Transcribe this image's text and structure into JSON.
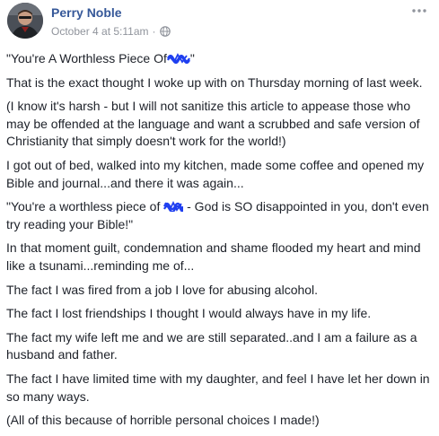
{
  "post": {
    "author_name": "Perry Noble",
    "timestamp": "October 4 at 5:11am",
    "separator": "·",
    "audience_icon": "globe-icon",
    "more_icon": "more-options-icon",
    "censor_color": "#1f3ff0",
    "link_color": "#365899",
    "paragraphs": {
      "p1_before": "\"You're A Worthless Piece Of",
      "p1_after": "\"",
      "p2": "That is the exact thought I woke up with on Thursday morning of last week.",
      "p3": "(I know it's harsh - but I will not sanitize this article to appease those who may be offended at the language and want a scrubbed and safe version of Christianity that simply doesn't work for the world!)",
      "p4": "I got out of bed, walked into my kitchen, made some coffee and opened my Bible and journal...and there it was again...",
      "p5_before": "\"You're a worthless piece of",
      "p5_after": "- God is SO disappointed in you, don't even try reading your Bible!\"",
      "p6": "In that moment guilt, condemnation and shame flooded my heart and mind like a tsunami...reminding me of...",
      "p7": "The fact I was fired from a job I love for abusing alcohol.",
      "p8": "The fact I lost friendships I thought I would always have in my life.",
      "p9": "The fact my wife left me and we are still separated..and I am a failure as a husband and father.",
      "p10": "The fact I have limited time with my daughter, and feel I have let her down in so many ways.",
      "p11": "(All of this because of horrible personal choices I made!)"
    }
  }
}
